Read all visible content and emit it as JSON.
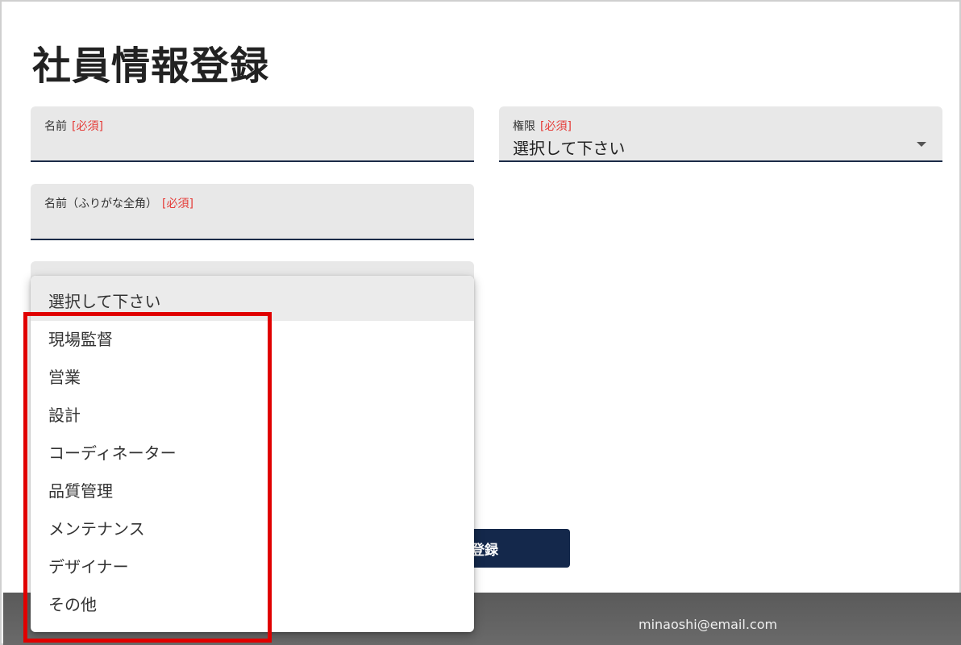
{
  "page": {
    "title": "社員情報登録"
  },
  "form": {
    "name": {
      "label": "名前",
      "required": "[必須]",
      "value": ""
    },
    "name_kana": {
      "label": "名前（ふりがな全角）",
      "required": "[必須]",
      "value": ""
    },
    "role": {
      "label": "権限",
      "required": "[必須]",
      "value": "選択して下さい"
    },
    "submit_label": "登録"
  },
  "dropdown": {
    "options": [
      "選択して下さい",
      "現場監督",
      "営業",
      "設計",
      "コーディネーター",
      "品質管理",
      "メンテナンス",
      "デザイナー",
      "その他"
    ]
  },
  "footer": {
    "email": "minaoshi@email.com"
  },
  "colors": {
    "accent": "#14284b",
    "required": "#e53935",
    "highlight": "#e00000",
    "field_bg": "#e8e8e8"
  }
}
